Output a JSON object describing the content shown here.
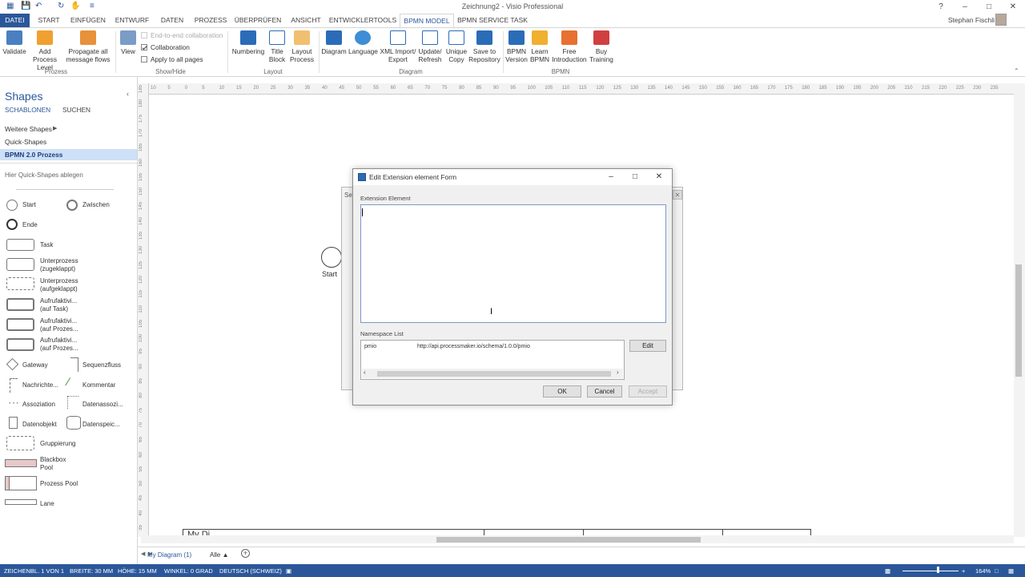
{
  "app": {
    "title": "Zeichnung2 - Visio Professional",
    "user": "Stephan Fischli"
  },
  "tabs": [
    "DATEI",
    "START",
    "EINFÜGEN",
    "ENTWURF",
    "DATEN",
    "PROZESS",
    "ÜBERPRÜFEN",
    "ANSICHT",
    "ENTWICKLERTOOLS",
    "BPMN MODEL",
    "BPMN SERVICE TASK"
  ],
  "ribbon": {
    "prozess": {
      "group": "Prozess",
      "validate": "Validate",
      "add_process": "Add Process Level",
      "propagate": "Propagate all message flows"
    },
    "showhide": {
      "group": "Show/Hide",
      "view": "View",
      "end_to_end": "End-to-end collaboration",
      "collaboration": "Collaboration",
      "apply_all": "Apply to all pages"
    },
    "layout": {
      "group": "Layout",
      "numbering": "Numbering",
      "title_block": "Title Block",
      "layout_process": "Layout Process"
    },
    "diagram": {
      "group": "Diagram",
      "diagram": "Diagram",
      "language": "Language",
      "xml": "XML Import/ Export",
      "update": "Update/ Refresh",
      "unique_copy": "Unique Copy",
      "save_repo": "Save to Repository"
    },
    "bpmn": {
      "group": "BPMN",
      "version": "BPMN Version",
      "learn": "Learn BPMN",
      "intro": "Free Introduction",
      "training": "Buy Training"
    }
  },
  "shapes_panel": {
    "title": "Shapes",
    "tab_templates": "SCHABLONEN",
    "tab_search": "SUCHEN",
    "more_shapes": "Weitere Shapes",
    "quick_shapes": "Quick-Shapes",
    "stencil_selected": "BPMN 2.0 Prozess",
    "drop_hint": "Hier Quick-Shapes ablegen",
    "items": {
      "start": "Start",
      "between": "Zwischen",
      "end": "Ende",
      "task": "Task",
      "subproc_collapsed": "Unterprozess (zugeklappt)",
      "subproc_expanded": "Unterprozess (aufgeklappt)",
      "call_task": "Aufrufaktivi... (auf Task)",
      "call_proc1": "Aufrufaktivi... (auf Prozes...",
      "call_proc2": "Aufrufaktivi... (auf Prozes...",
      "gateway": "Gateway",
      "seqflow": "Sequenzfluss",
      "msgflow": "Nachrichte...",
      "comment": "Kommentar",
      "association": "Assoziation",
      "data_assoc": "Datenassozi...",
      "data_object": "Datenobjekt",
      "data_store": "Datenspeic...",
      "group": "Gruppierung",
      "blackbox": "Blackbox Pool",
      "process_pool": "Prozess Pool",
      "lane": "Lane"
    }
  },
  "ruler": {
    "h": [
      "10",
      "5",
      "0",
      "5",
      "10",
      "15",
      "20",
      "25",
      "30",
      "35",
      "40",
      "45",
      "50",
      "55",
      "60",
      "65",
      "70",
      "75",
      "80",
      "85",
      "90",
      "95",
      "100",
      "105",
      "110",
      "115",
      "120",
      "125",
      "130",
      "135",
      "140",
      "145",
      "150",
      "155",
      "160",
      "165",
      "170",
      "175",
      "180",
      "185",
      "190",
      "195",
      "200",
      "205",
      "210",
      "215",
      "220",
      "225",
      "230",
      "235"
    ],
    "v": [
      "185",
      "180",
      "175",
      "170",
      "165",
      "160",
      "155",
      "150",
      "145",
      "140",
      "135",
      "130",
      "125",
      "120",
      "115",
      "110",
      "105",
      "100",
      "95",
      "90",
      "85",
      "80",
      "75",
      "70",
      "65",
      "60",
      "55",
      "50",
      "45",
      "40",
      "35"
    ]
  },
  "canvas": {
    "start_label": "Start",
    "bg_dialog_label": "Se",
    "pool_label": "My Di"
  },
  "dialog": {
    "title": "Edit Extension element Form",
    "extension_label": "Extension Element",
    "extension_value": "",
    "namespace_label": "Namespace List",
    "ns_prefix": "pmio",
    "ns_uri": "http://api.processmaker.io/schema/1.0.0/pmio",
    "edit": "Edit",
    "ok": "OK",
    "cancel": "Cancel",
    "accept": "Accept"
  },
  "pages": {
    "current": "My Diagram (1)",
    "all": "Alle"
  },
  "status": {
    "page": "ZEICHENBL. 1 VON 1",
    "width": "BREITE: 30 MM",
    "height": "HÖHE: 15 MM",
    "angle": "WINKEL: 0 GRAD",
    "language": "DEUTSCH (SCHWEIZ)",
    "zoom": "164%"
  },
  "colors": {
    "accent": "#2b579a",
    "selected_stencil": "#cde0f7"
  }
}
